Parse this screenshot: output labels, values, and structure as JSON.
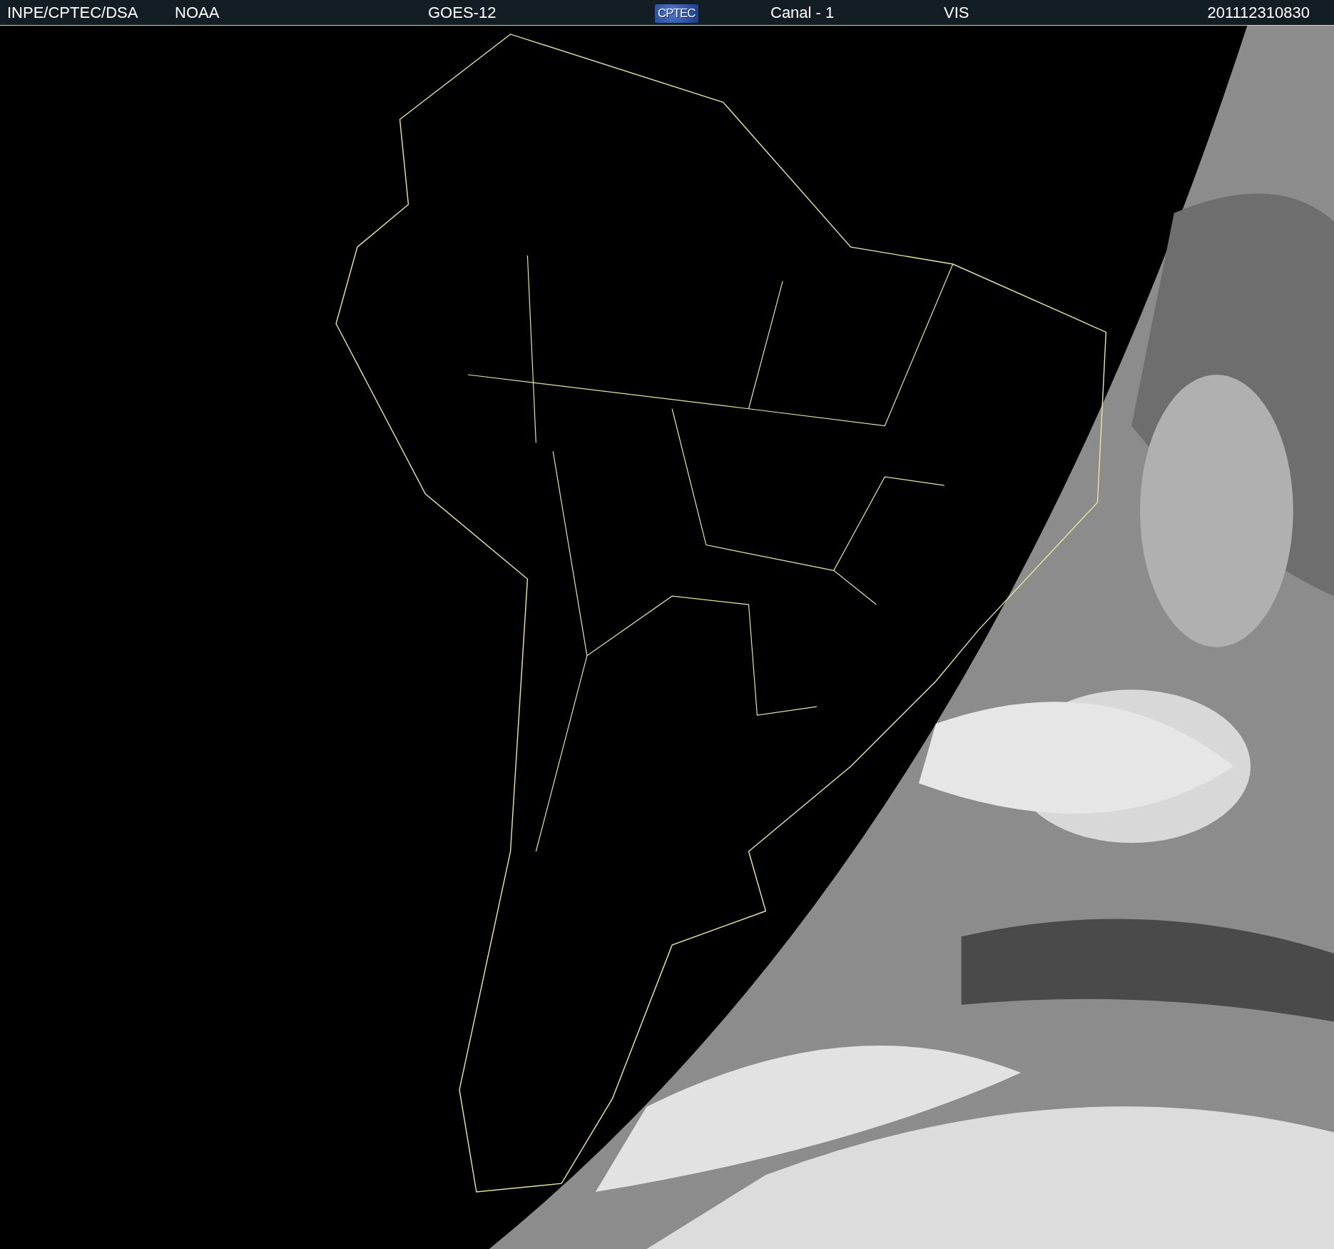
{
  "header": {
    "items": [
      {
        "kind": "text",
        "text": "INPE/CPTEC/DSA"
      },
      {
        "kind": "text",
        "text": "NOAA"
      },
      {
        "kind": "text",
        "text": "GOES-12"
      },
      {
        "kind": "logo",
        "text": "CPTEC"
      },
      {
        "kind": "text",
        "text": "Canal - 1"
      },
      {
        "kind": "text",
        "text": "VIS"
      },
      {
        "kind": "text",
        "text": "201112310830"
      }
    ]
  }
}
